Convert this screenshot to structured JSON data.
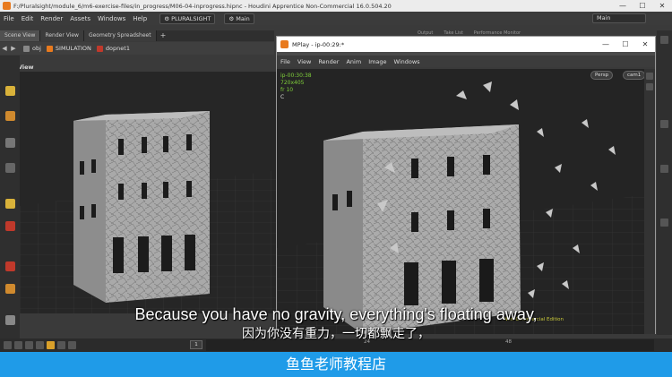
{
  "window": {
    "title": "F:/Pluralsight/module_6/m6-exercise-files/in_progress/M06-04-inprogress.hipnc - Houdini Apprentice Non-Commercial 16.0.504.20",
    "minimize": "—",
    "maximize": "☐",
    "close": "✕"
  },
  "menubar": {
    "items": [
      "File",
      "Edit",
      "Render",
      "Assets",
      "Windows",
      "Help"
    ],
    "shelf_set": "PLURALSIGHT",
    "desktop": "Main",
    "right_desktop": "Main"
  },
  "pane": {
    "tabs": [
      "Scene View",
      "Render View",
      "Geometry Spreadsheet"
    ],
    "add_tab": "+",
    "path": [
      "obj",
      "SIMULATION",
      "dopnet1"
    ],
    "view_label": "View"
  },
  "right_tabs": [
    "Output",
    "Take List",
    "Performance Monitor"
  ],
  "mplay": {
    "title": "MPlay - ip-00:29:*",
    "menu": [
      "File",
      "View",
      "Render",
      "Anim",
      "Image",
      "Windows"
    ],
    "hud_time": "ip-00:30:38",
    "hud_res": "720x405",
    "hud_frame": "fr 10",
    "hud_c": "C",
    "persp": "Persp",
    "cam": "cam1",
    "nc_label": "Non-Commercial Edition"
  },
  "timeline": {
    "frame": "1",
    "ticks": [
      "24",
      "48"
    ]
  },
  "subtitles": {
    "english": "Because you have no gravity, everything's floating away,",
    "chinese": "因为你没有重力，一切都飘走了，"
  },
  "banner": {
    "text": "鱼鱼老师教程店"
  },
  "colors": {
    "accent": "#e87a1e",
    "hud": "#7fcf3a",
    "banner": "#1f9be8"
  }
}
